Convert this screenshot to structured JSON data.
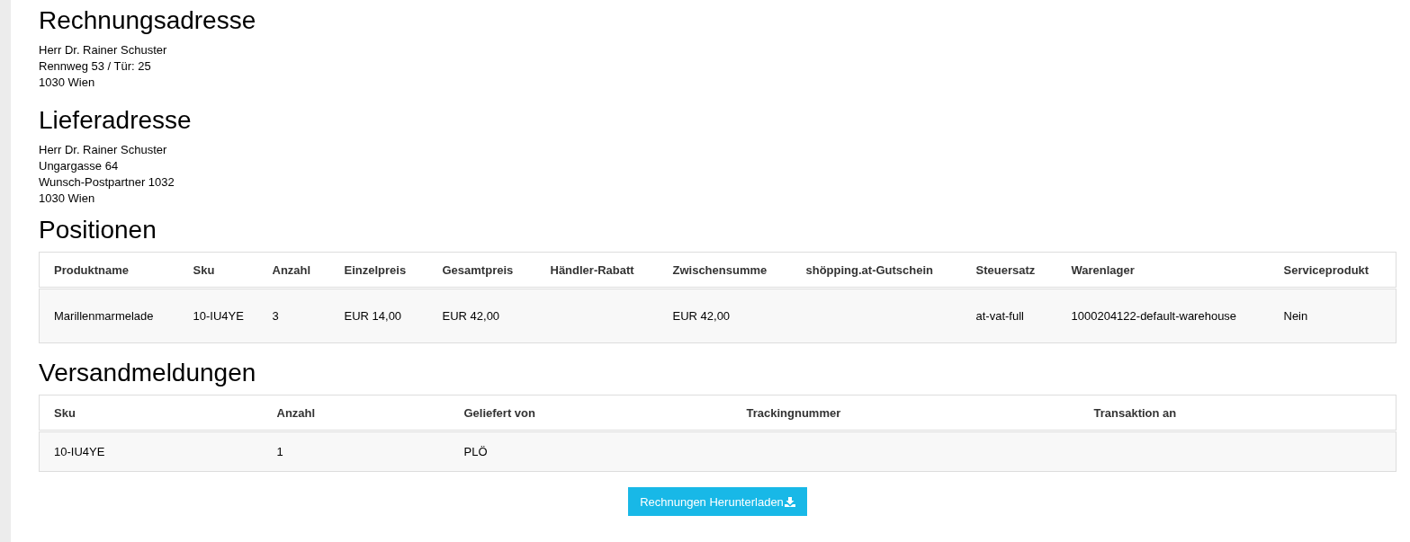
{
  "billing_address": {
    "heading": "Rechnungsadresse",
    "lines": [
      "Herr Dr. Rainer Schuster",
      "Rennweg 53 / Tür: 25",
      "1030 Wien"
    ]
  },
  "delivery_address": {
    "heading": "Lieferadresse",
    "lines": [
      "Herr Dr. Rainer Schuster",
      "Ungargasse 64",
      "Wunsch-Postpartner 1032",
      "1030 Wien"
    ]
  },
  "positions": {
    "heading": "Positionen",
    "columns": [
      "Produktname",
      "Sku",
      "Anzahl",
      "Einzelpreis",
      "Gesamtpreis",
      "Händler-Rabatt",
      "Zwischensumme",
      "shöpping.at-Gutschein",
      "Steuersatz",
      "Warenlager",
      "Serviceprodukt"
    ],
    "rows": [
      [
        "Marillenmarmelade",
        "10-IU4YE",
        "3",
        "EUR 14,00",
        "EUR 42,00",
        null,
        "EUR 42,00",
        null,
        "at-vat-full",
        "1000204122-default-warehouse",
        "Nein"
      ]
    ]
  },
  "shipping_notices": {
    "heading": "Versandmeldungen",
    "columns": [
      "Sku",
      "Anzahl",
      "Geliefert von",
      "Trackingnummer",
      "Transaktion an"
    ],
    "rows": [
      [
        "10-IU4YE",
        "1",
        "PLÖ",
        null,
        null
      ]
    ]
  },
  "download_button": {
    "label": "Rechnungen Herunterladen"
  }
}
